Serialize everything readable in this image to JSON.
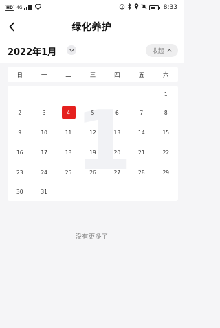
{
  "status_bar": {
    "network": "HD",
    "signal_type": "4G",
    "time": "8:33",
    "icons": [
      "hd-icon",
      "signal-icon",
      "heart-icon",
      "alarm-icon",
      "bluetooth-icon",
      "location-icon",
      "mute-icon",
      "battery-icon"
    ]
  },
  "nav": {
    "title": "绿化养护",
    "back_icon": "back-arrow-icon"
  },
  "month_selector": {
    "label": "2022年1月",
    "toggle_icon": "chevron-down-icon",
    "collapse_label": "收起",
    "collapse_icon": "chevron-up-icon"
  },
  "weekdays": [
    "日",
    "一",
    "二",
    "三",
    "四",
    "五",
    "六"
  ],
  "calendar": {
    "watermark": "1",
    "selected_day": "4",
    "rows": [
      [
        "",
        "",
        "",
        "",
        "",
        "",
        "1"
      ],
      [
        "2",
        "3",
        "4",
        "5",
        "6",
        "7",
        "8"
      ],
      [
        "9",
        "10",
        "11",
        "12",
        "13",
        "14",
        "15"
      ],
      [
        "16",
        "17",
        "18",
        "19",
        "20",
        "21",
        "22"
      ],
      [
        "23",
        "24",
        "25",
        "26",
        "27",
        "28",
        "29"
      ],
      [
        "30",
        "31",
        "",
        "",
        "",
        "",
        ""
      ]
    ]
  },
  "footer": {
    "empty_text": "没有更多了"
  },
  "colors": {
    "accent": "#e5201e",
    "background": "#f5f5f7"
  }
}
